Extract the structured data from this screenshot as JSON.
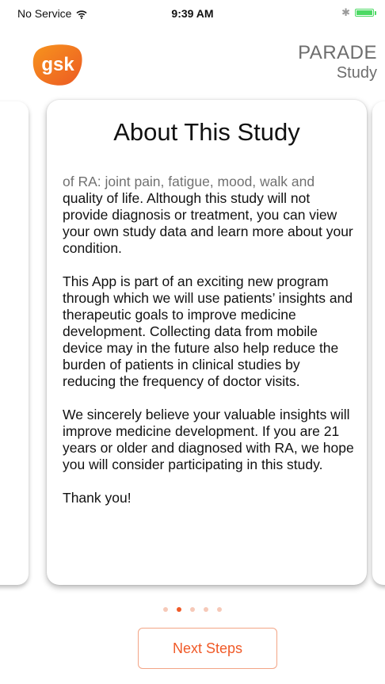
{
  "status_bar": {
    "carrier": "No Service",
    "time": "9:39 AM",
    "bluetooth_symbol": "✱",
    "icons": [
      "wifi-icon",
      "bluetooth-icon",
      "battery-icon"
    ],
    "battery_color": "#4cd964"
  },
  "header": {
    "logo_text": "gsk",
    "logo_color": "#f05a28",
    "title": "PARADE",
    "subtitle": "Study"
  },
  "card": {
    "title": "About This Study",
    "paragraphs": [
      "of RA: joint pain, fatigue, mood, walk and quality of life. Although this study will not provide diagnosis or treatment, you can view your own study data and learn more about your condition.",
      "This App is part of an exciting new program through which we will use patients’ insights and therapeutic goals to improve medicine development. Collecting data from mobile device may in the future also help reduce the burden of patients in clinical studies by reducing the frequency of doctor visits.",
      "We sincerely believe your valuable insights will improve medicine development. If you are 21 years or older and diagnosed with RA, we hope you will consider participating in this study.",
      "Thank you!"
    ]
  },
  "pagination": {
    "total": 5,
    "current": 2,
    "active_color": "#f05a28",
    "inactive_color": "#f6c9b8"
  },
  "next_button": {
    "label": "Next Steps",
    "color": "#f05a28"
  }
}
